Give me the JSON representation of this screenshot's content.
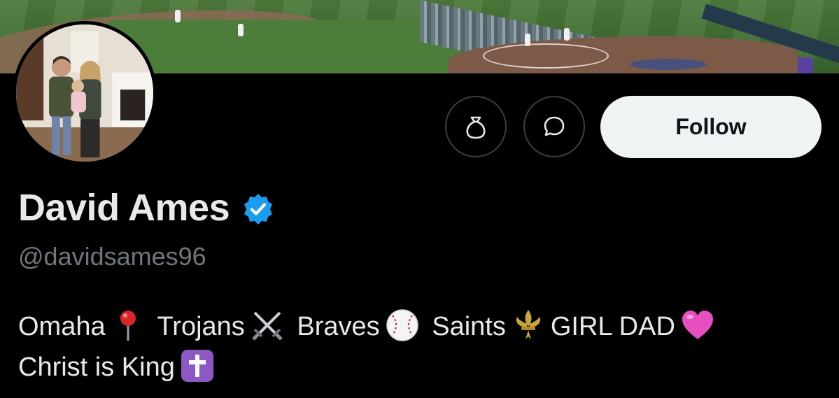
{
  "profile": {
    "display_name": "David Ames",
    "handle": "@davidsames96",
    "verified": true,
    "verified_color": "#1d9bf0"
  },
  "actions": {
    "tip_icon": "money-bag-icon",
    "message_icon": "message-bubble-icon",
    "follow_label": "Follow"
  },
  "bio": {
    "line1": [
      {
        "text": "Omaha",
        "emoji": "round-pushpin-icon"
      },
      {
        "text": "Trojans",
        "emoji": "crossed-swords-icon"
      },
      {
        "text": "Braves",
        "emoji": "baseball-icon"
      },
      {
        "text": "Saints",
        "emoji": "fleur-de-lis-icon"
      },
      {
        "text": "GIRL DAD",
        "emoji": "pink-heart-icon"
      }
    ],
    "line2": [
      {
        "text": "Christ is King",
        "emoji": "latin-cross-icon"
      }
    ]
  },
  "colors": {
    "background": "#000000",
    "text_primary": "#e7e9ea",
    "text_secondary": "#71767b",
    "follow_bg": "#eff3f4",
    "follow_text": "#0f1419"
  }
}
